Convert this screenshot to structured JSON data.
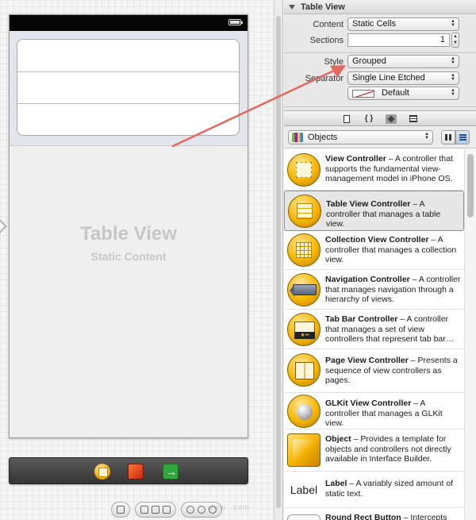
{
  "canvas": {
    "placeholder_title": "Table View",
    "placeholder_subtitle": "Static Content",
    "watermark": "www.  .com"
  },
  "inspector": {
    "section_title": "Table View",
    "rows": {
      "content": {
        "label": "Content",
        "value": "Static Cells"
      },
      "sections": {
        "label": "Sections",
        "value": "1"
      },
      "style": {
        "label": "Style",
        "value": "Grouped"
      },
      "separator": {
        "label": "Separator",
        "value": "Single Line Etched"
      },
      "separator_color": {
        "value": "Default"
      }
    }
  },
  "library": {
    "filter_value": "Objects",
    "items": [
      {
        "name": "View Controller",
        "desc": " – A controller that supports the fundamental view-management model in iPhone OS."
      },
      {
        "name": "Table View Controller",
        "desc": " – A controller that manages a table view."
      },
      {
        "name": "Collection View Controller",
        "desc": " – A controller that manages a collection view."
      },
      {
        "name": "Navigation Controller",
        "desc": " – A controller that manages navigation through a hierarchy of views."
      },
      {
        "name": "Tab Bar Controller",
        "desc": " – A controller that manages a set of view controllers that represent tab bar…"
      },
      {
        "name": "Page View Controller",
        "desc": " – Presents a sequence of view controllers as pages."
      },
      {
        "name": "GLKit View Controller",
        "desc": " – A controller that manages a GLKit view."
      },
      {
        "name": "Object",
        "desc": " – Provides a template for objects and controllers not directly available in Interface Builder."
      },
      {
        "name": "Label",
        "desc": " – A variably sized amount of static text.",
        "glyph": "Label"
      },
      {
        "name": "Round Rect Button",
        "desc": " – Intercepts"
      }
    ]
  },
  "colors": {
    "annotation_arrow": "#e8675c",
    "separator_color": "#dd0000"
  }
}
